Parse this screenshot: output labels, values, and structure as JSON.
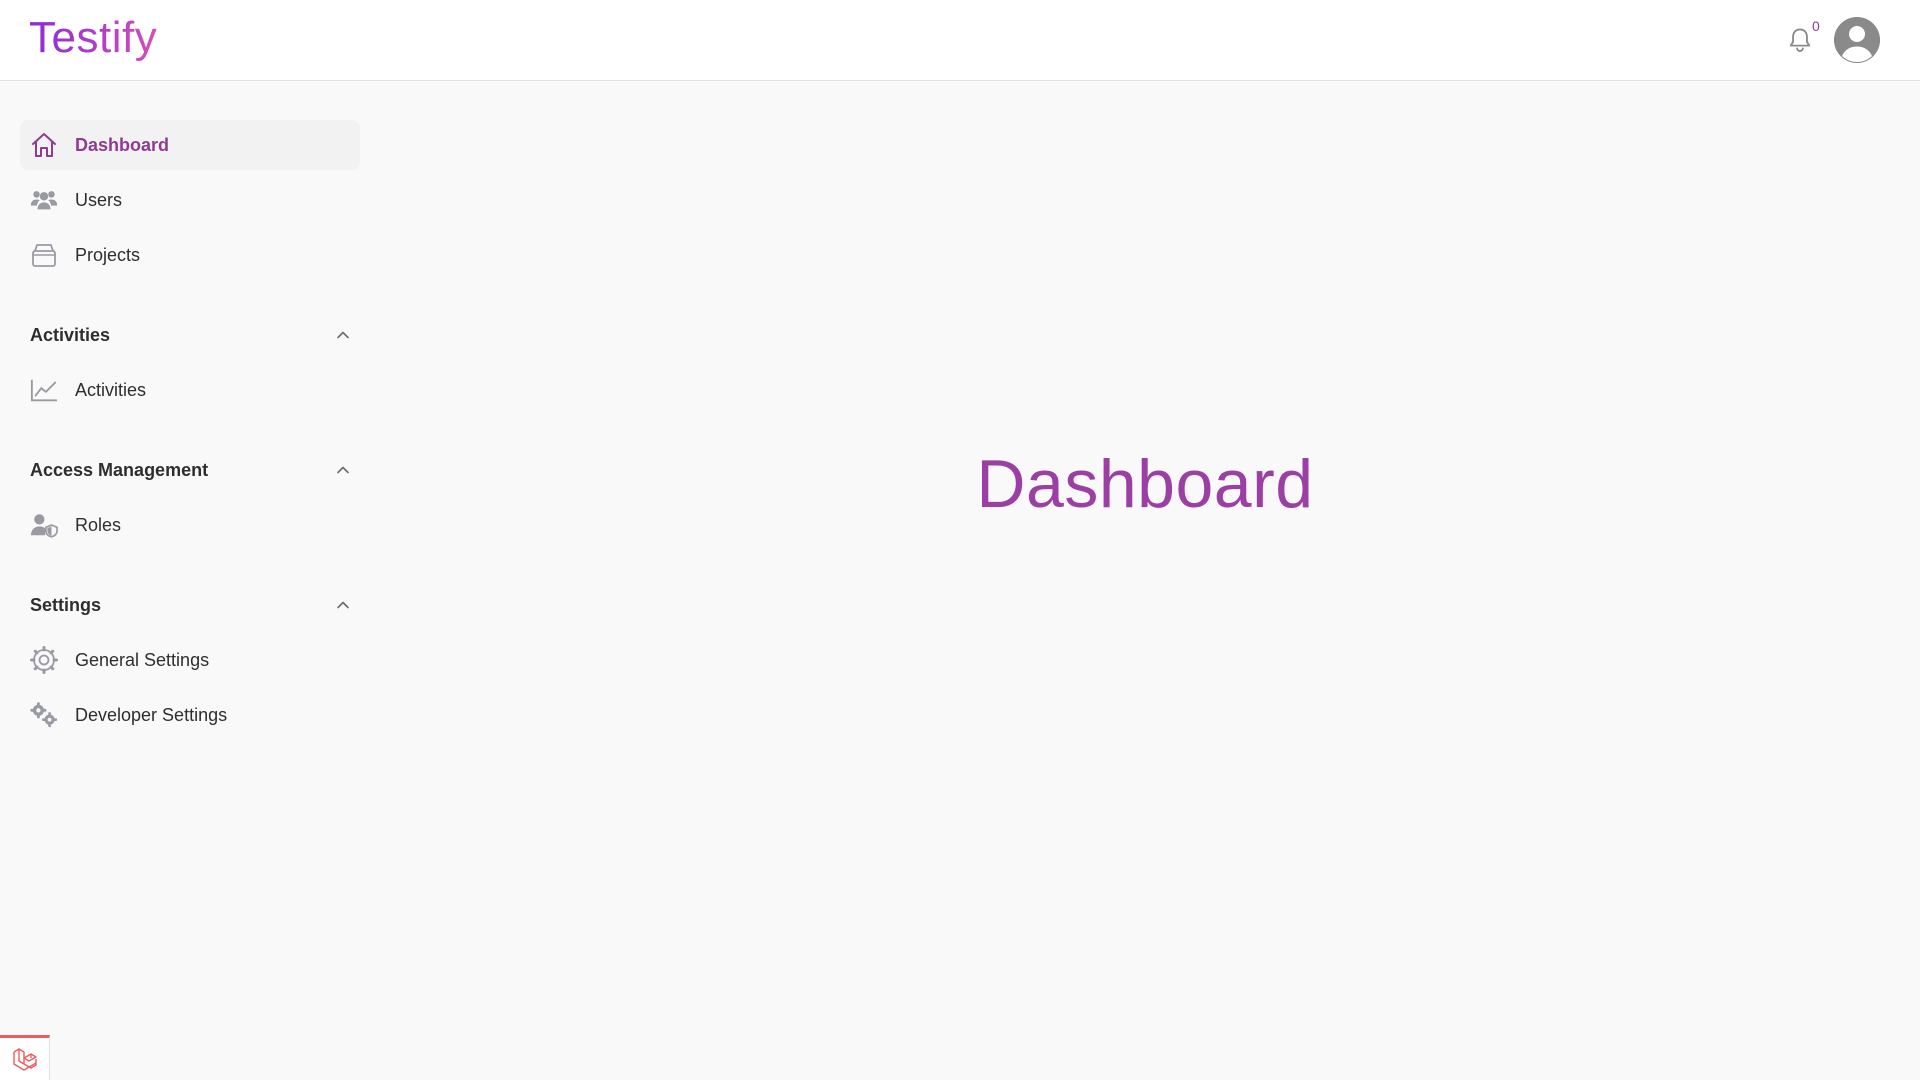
{
  "header": {
    "logo": "Testify",
    "notifications_count": "0"
  },
  "sidebar": {
    "items": [
      {
        "label": "Dashboard",
        "icon": "home-icon",
        "active": true
      },
      {
        "label": "Users",
        "icon": "users-icon"
      },
      {
        "label": "Projects",
        "icon": "archive-icon"
      }
    ],
    "groups": [
      {
        "title": "Activities",
        "expanded": true,
        "items": [
          {
            "label": "Activities",
            "icon": "chart-line-icon"
          }
        ]
      },
      {
        "title": "Access Management",
        "expanded": true,
        "items": [
          {
            "label": "Roles",
            "icon": "user-shield-icon"
          }
        ]
      },
      {
        "title": "Settings",
        "expanded": true,
        "items": [
          {
            "label": "General Settings",
            "icon": "gear-icon"
          },
          {
            "label": "Developer Settings",
            "icon": "gears-icon"
          }
        ]
      }
    ]
  },
  "main": {
    "title": "Dashboard"
  },
  "colors": {
    "accent": "#8e3b94",
    "title": "#9b3fa5",
    "icon_gray": "#9a9aa3"
  }
}
